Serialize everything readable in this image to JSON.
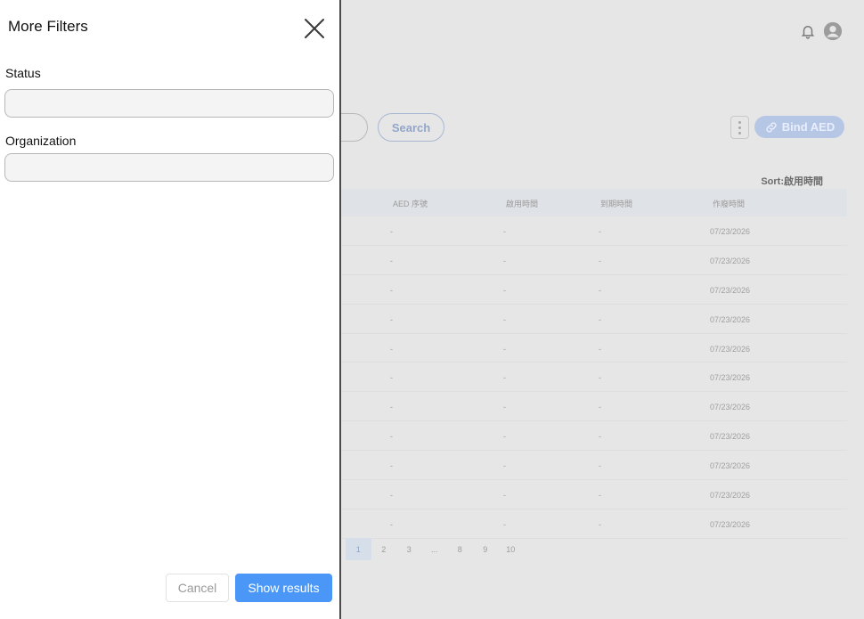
{
  "drawer": {
    "title": "More Filters",
    "status_label": "Status",
    "status_value": "",
    "organization_label": "Organization",
    "organization_value": "",
    "cancel_label": "Cancel",
    "show_results_label": "Show results"
  },
  "toolbar": {
    "search_label": "Search",
    "bind_label": "Bind AED",
    "sort_label": "Sort:啟用時間"
  },
  "table": {
    "headers": [
      "AED 序號",
      "啟用時間",
      "到期時間",
      "作廢時間"
    ],
    "rows": [
      [
        "-",
        "-",
        "-",
        "07/23/2026"
      ],
      [
        "-",
        "-",
        "-",
        "07/23/2026"
      ],
      [
        "-",
        "-",
        "-",
        "07/23/2026"
      ],
      [
        "-",
        "-",
        "-",
        "07/23/2026"
      ],
      [
        "-",
        "-",
        "-",
        "07/23/2026"
      ],
      [
        "-",
        "-",
        "-",
        "07/23/2026"
      ],
      [
        "-",
        "-",
        "-",
        "07/23/2026"
      ],
      [
        "-",
        "-",
        "-",
        "07/23/2026"
      ],
      [
        "-",
        "-",
        "-",
        "07/23/2026"
      ],
      [
        "-",
        "-",
        "-",
        "07/23/2026"
      ],
      [
        "-",
        "-",
        "-",
        "07/23/2026"
      ]
    ]
  },
  "pagination": {
    "pages": [
      "1",
      "2",
      "3",
      "...",
      "8",
      "9",
      "10"
    ],
    "current": "1"
  },
  "colors": {
    "primary": "#4b97f7",
    "overlay_bg": "#e6e6e6"
  }
}
